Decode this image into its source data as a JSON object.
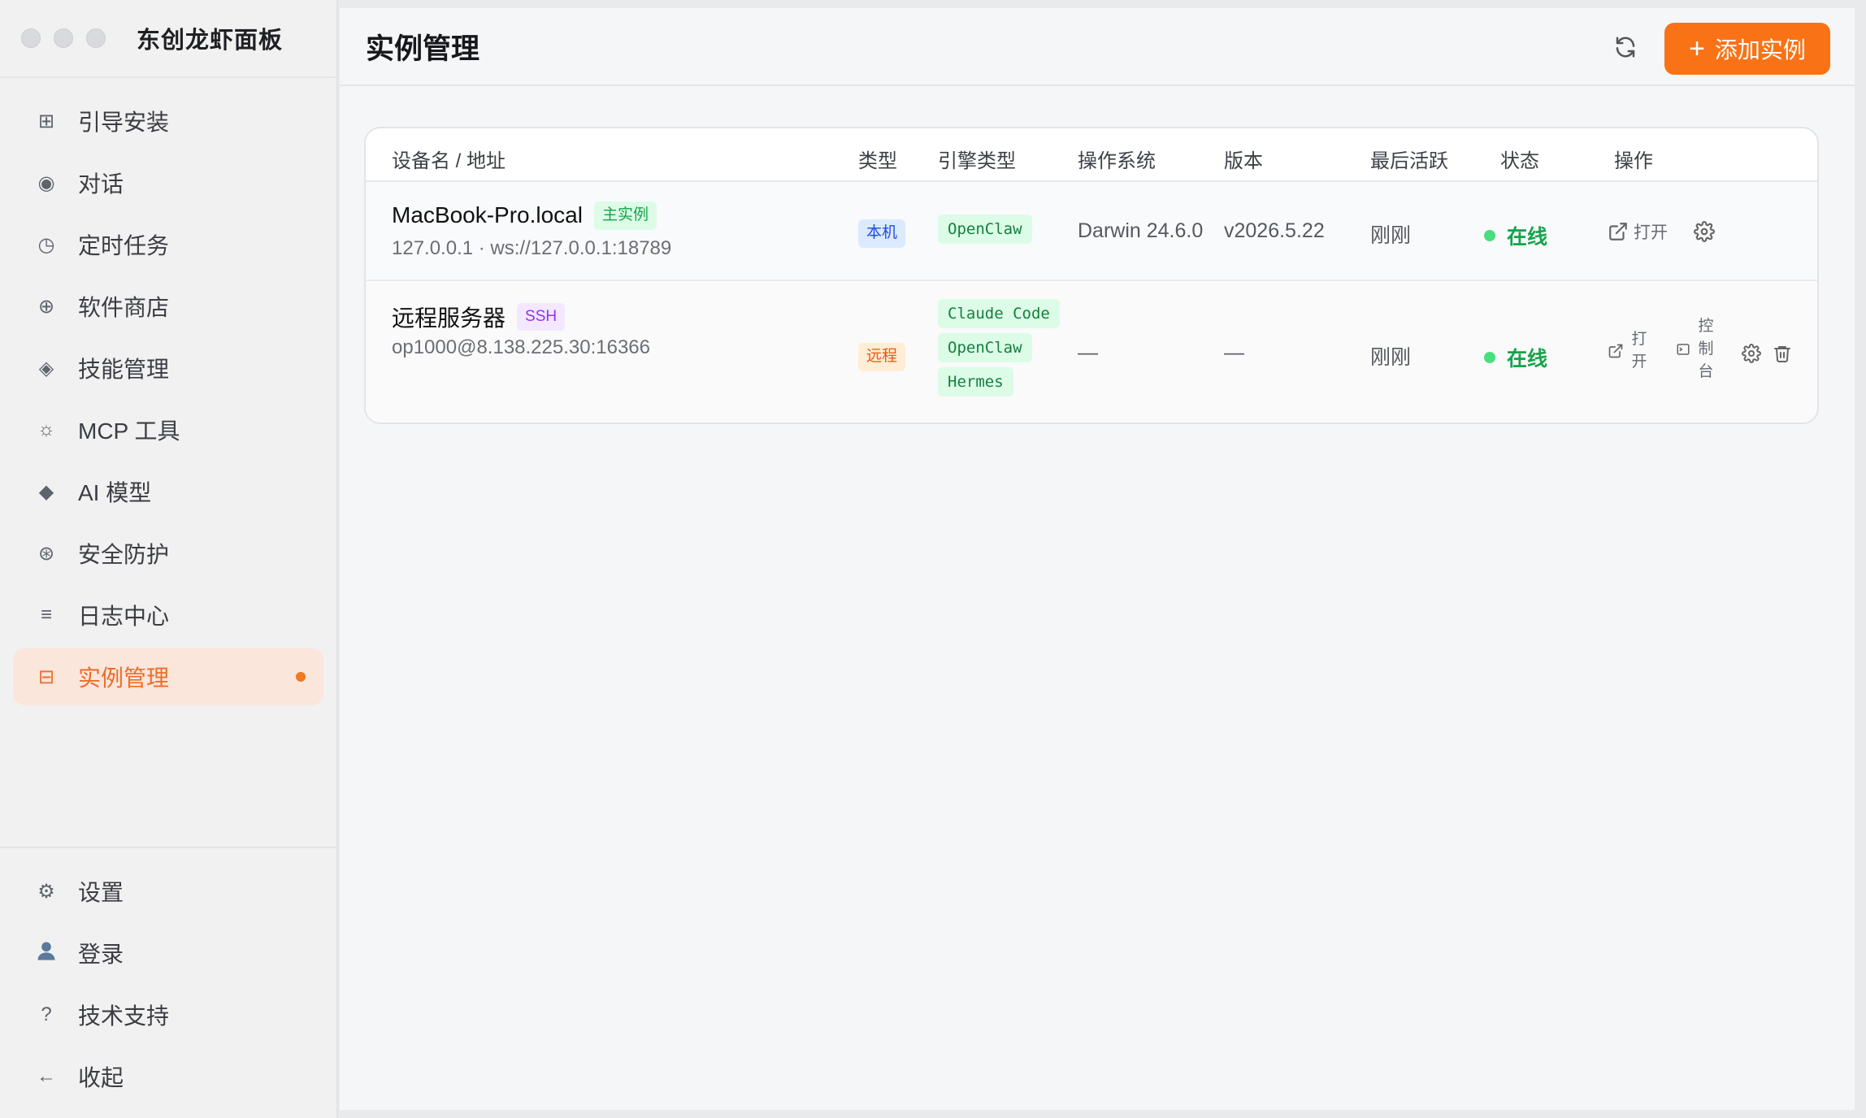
{
  "app": {
    "title": "东创龙虾面板"
  },
  "sidebar": {
    "items": [
      {
        "label": "引导安装",
        "icon": "grid-icon"
      },
      {
        "label": "对话",
        "icon": "chat-dot-icon"
      },
      {
        "label": "定时任务",
        "icon": "clock-icon"
      },
      {
        "label": "软件商店",
        "icon": "plus-circle-icon"
      },
      {
        "label": "技能管理",
        "icon": "diamond-outline-icon"
      },
      {
        "label": "MCP 工具",
        "icon": "sun-gear-icon"
      },
      {
        "label": "AI 模型",
        "icon": "diamond-icon"
      },
      {
        "label": "安全防护",
        "icon": "shield-asterisk-icon"
      },
      {
        "label": "日志中心",
        "icon": "lines-icon"
      },
      {
        "label": "实例管理",
        "icon": "instance-icon",
        "active": true
      }
    ],
    "bottom": [
      {
        "label": "设置",
        "icon": "gear-icon"
      },
      {
        "label": "登录",
        "icon": "user-icon"
      },
      {
        "label": "技术支持",
        "icon": "question-icon"
      },
      {
        "label": "收起",
        "icon": "arrow-left-icon"
      }
    ]
  },
  "header": {
    "title": "实例管理",
    "add_label": "添加实例"
  },
  "table": {
    "columns": [
      "设备名 / 地址",
      "类型",
      "引擎类型",
      "操作系统",
      "版本",
      "最后活跃",
      "状态",
      "操作"
    ],
    "rows": [
      {
        "name": "MacBook-Pro.local",
        "badge": "主实例",
        "address": "127.0.0.1 · ws://127.0.0.1:18789",
        "type": "本机",
        "engines": [
          "OpenClaw"
        ],
        "os": "Darwin 24.6.0",
        "version": "v2026.5.22",
        "last_active": "刚刚",
        "status": "在线",
        "actions": {
          "open": "打开"
        }
      },
      {
        "name": "远程服务器",
        "badge": "SSH",
        "address": "op1000@8.138.225.30:16366",
        "type": "远程",
        "engines": [
          "Claude Code",
          "OpenClaw",
          "Hermes"
        ],
        "os": "—",
        "version": "—",
        "last_active": "刚刚",
        "status": "在线",
        "actions": {
          "open_chars": [
            "打",
            "开"
          ],
          "console_chars": [
            "控",
            "制",
            "台"
          ]
        }
      }
    ]
  },
  "colors": {
    "accent": "#f97316",
    "active_bg": "#fbe6dc",
    "online": "#16a34a"
  }
}
